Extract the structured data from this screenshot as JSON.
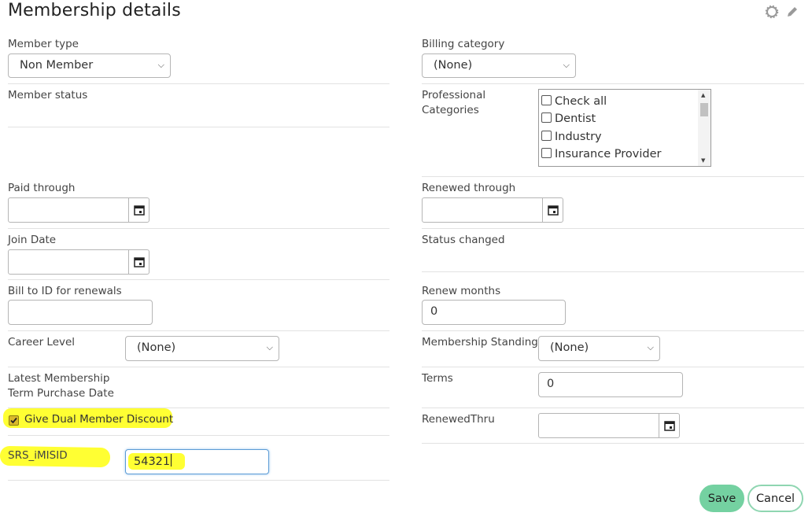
{
  "page": {
    "title": "Membership details"
  },
  "header_icons": {
    "settings": "gear-icon",
    "edit": "pencil-icon"
  },
  "left": {
    "member_type": {
      "label": "Member type",
      "value": "Non Member"
    },
    "member_status": {
      "label": "Member status"
    },
    "paid_through": {
      "label": "Paid through",
      "value": ""
    },
    "join_date": {
      "label": "Join Date",
      "value": ""
    },
    "bill_to": {
      "label": "Bill to ID for renewals",
      "value": ""
    },
    "career_level": {
      "label": "Career Level",
      "value": "(None)"
    },
    "latest_membership": {
      "label_line1": "Latest Membership",
      "label_line2": "Term Purchase Date"
    },
    "dual_discount": {
      "label": "Give Dual Member Discount",
      "checked": true
    },
    "srs_imisid": {
      "label": "SRS_iMISID",
      "value": "54321"
    }
  },
  "right": {
    "billing_category": {
      "label": "Billing category",
      "value": "(None)"
    },
    "professional_categories": {
      "label_line1": "Professional",
      "label_line2": "Categories",
      "options": [
        "Check all",
        "Dentist",
        "Industry",
        "Insurance Provider"
      ]
    },
    "renewed_through": {
      "label": "Renewed through",
      "value": ""
    },
    "status_changed": {
      "label": "Status changed"
    },
    "renew_months": {
      "label": "Renew months",
      "value": "0"
    },
    "membership_standing": {
      "label": "Membership Standing",
      "value": "(None)"
    },
    "terms": {
      "label": "Terms",
      "value": "0"
    },
    "renewed_thru": {
      "label": "RenewedThru",
      "value": ""
    }
  },
  "actions": {
    "save": "Save",
    "cancel": "Cancel"
  },
  "colors": {
    "save_bg": "#74d1a1",
    "cancel_border": "#8fd6b1",
    "highlight": "#ffff33"
  }
}
